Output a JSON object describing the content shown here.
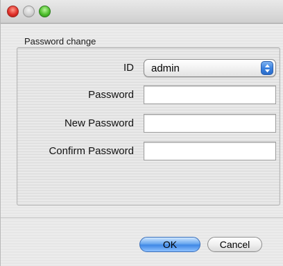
{
  "window": {
    "controls": [
      "close-icon",
      "minimize-icon",
      "zoom-icon"
    ]
  },
  "group": {
    "title": "Password change"
  },
  "form": {
    "id_label": "ID",
    "id_value": "admin",
    "password_label": "Password",
    "password_value": "",
    "new_password_label": "New Password",
    "new_password_value": "",
    "confirm_password_label": "Confirm Password",
    "confirm_password_value": ""
  },
  "buttons": {
    "ok_label": "OK",
    "cancel_label": "Cancel"
  },
  "colors": {
    "default_button": "#3f88e6",
    "close": "#e0302a",
    "zoom": "#4fbf2e"
  }
}
